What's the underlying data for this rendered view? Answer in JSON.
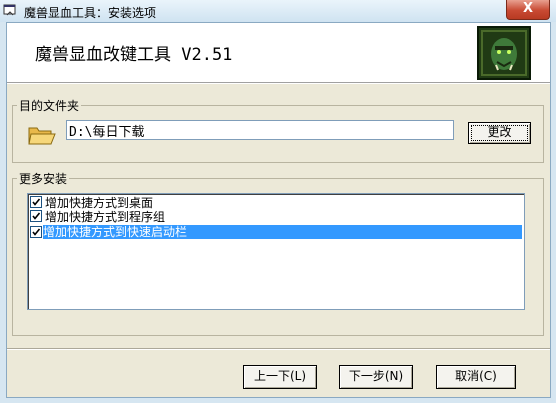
{
  "window": {
    "title": "魔兽显血工具：安装选项",
    "close_label": "X"
  },
  "header": {
    "title": "魔兽显血改键工具 V2.51"
  },
  "destination": {
    "legend": "目的文件夹",
    "path": "D:\\每日下载",
    "change_label": "更改"
  },
  "more_install": {
    "legend": "更多安装",
    "items": [
      {
        "label": "增加快捷方式到桌面",
        "checked": true,
        "selected": false
      },
      {
        "label": "增加快捷方式到程序组",
        "checked": true,
        "selected": false
      },
      {
        "label": "增加快捷方式到快速启动栏",
        "checked": true,
        "selected": true
      }
    ]
  },
  "footer": {
    "back_label": "上一下(L)",
    "next_label": "下一步(N)",
    "cancel_label": "取消(C)"
  },
  "colors": {
    "selection": "#3399ff",
    "close_button": "#c84a33"
  }
}
